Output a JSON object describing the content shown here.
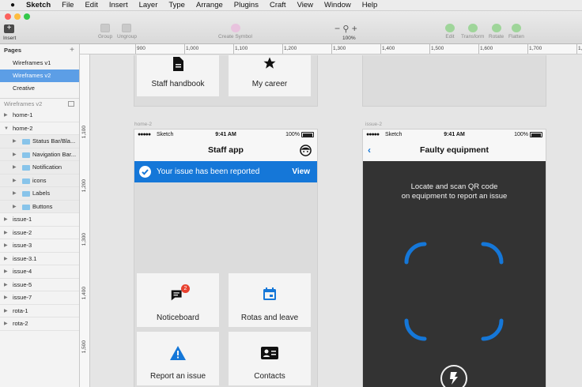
{
  "menubar": {
    "app_name": "Sketch",
    "items": [
      "File",
      "Edit",
      "Insert",
      "Layer",
      "Type",
      "Arrange",
      "Plugins",
      "Craft",
      "View",
      "Window",
      "Help"
    ]
  },
  "toolbar": {
    "insert_label": "Insert",
    "group_label": "Group",
    "ungroup_label": "Ungroup",
    "create_symbol_label": "Create Symbol",
    "zoom_label": "100%",
    "edit_label": "Edit",
    "transform_label": "Transform",
    "rotate_label": "Rotate",
    "flatten_label": "Flatten"
  },
  "sidebar": {
    "pages_title": "Pages",
    "pages": [
      "Wireframes v1",
      "Wireframes v2",
      "Creative"
    ],
    "selected_page": "Wireframes v2",
    "layers_title": "Wireframes v2",
    "layers": [
      {
        "label": "home-1",
        "level": 0,
        "expanded": false
      },
      {
        "label": "home-2",
        "level": 0,
        "expanded": true
      },
      {
        "label": "Status Bar/Bla...",
        "level": 1
      },
      {
        "label": "Navigation Bar...",
        "level": 1
      },
      {
        "label": "Notification",
        "level": 1
      },
      {
        "label": "icons",
        "level": 1
      },
      {
        "label": "Labels",
        "level": 1
      },
      {
        "label": "Buttons",
        "level": 1
      },
      {
        "label": "issue-1",
        "level": 0,
        "expanded": false
      },
      {
        "label": "issue-2",
        "level": 0,
        "expanded": false
      },
      {
        "label": "issue-3",
        "level": 0,
        "expanded": false
      },
      {
        "label": "issue-3.1",
        "level": 0,
        "expanded": false
      },
      {
        "label": "issue-4",
        "level": 0,
        "expanded": false
      },
      {
        "label": "issue-5",
        "level": 0,
        "expanded": false
      },
      {
        "label": "issue-7",
        "level": 0,
        "expanded": false
      },
      {
        "label": "rota-1",
        "level": 0,
        "expanded": false
      },
      {
        "label": "rota-2",
        "level": 0,
        "expanded": false
      }
    ]
  },
  "rulers": {
    "top": [
      "900",
      "1,000",
      "1,100",
      "1,200",
      "1,300",
      "1,400",
      "1,500",
      "1,600",
      "1,700",
      "1,8"
    ],
    "left": [
      "1,100",
      "1,200",
      "1,300",
      "1,400",
      "1,500"
    ]
  },
  "artboards": {
    "top_tiles": [
      {
        "label": "Staff handbook",
        "icon": "document-icon"
      },
      {
        "label": "My career",
        "icon": "star-icon"
      }
    ],
    "home2": {
      "name": "home-2",
      "status": {
        "signal": "●●●●●",
        "carrier": "Sketch",
        "time": "9:41 AM",
        "battery": "100%"
      },
      "title": "Staff app",
      "banner": {
        "message": "Your issue has been reported",
        "action": "View"
      },
      "tiles": [
        {
          "label": "Noticeboard",
          "icon": "chat-icon",
          "badge": "2"
        },
        {
          "label": "Rotas and leave",
          "icon": "calendar-icon"
        },
        {
          "label": "Report an issue",
          "icon": "warning-icon"
        },
        {
          "label": "Contacts",
          "icon": "contacts-icon"
        }
      ]
    },
    "issue2": {
      "name": "issue-2",
      "status": {
        "signal": "●●●●●",
        "carrier": "Sketch",
        "time": "9:41 AM",
        "battery": "100%"
      },
      "title": "Faulty equipment",
      "instruction_line1": "Locate and scan QR code",
      "instruction_line2": "on equipment to report an issue"
    }
  },
  "colors": {
    "accent": "#1577d8",
    "selection": "#5c9ee6",
    "dark_screen": "#333333",
    "badge": "#e8412f"
  }
}
